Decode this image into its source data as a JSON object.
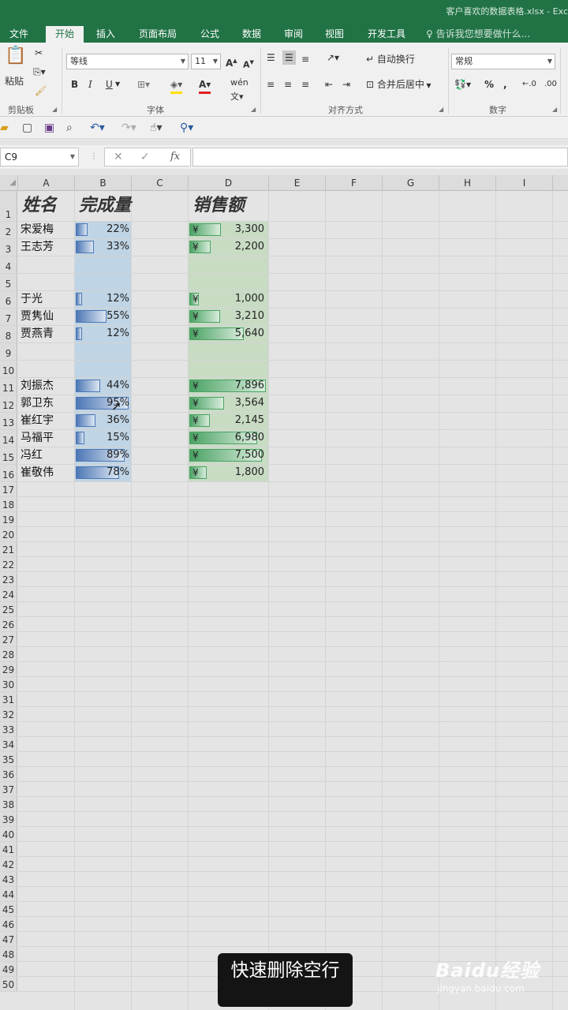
{
  "window": {
    "title": "客户喜欢的数据表格.xlsx - Exc"
  },
  "tabs": [
    {
      "label": "文件",
      "active": false
    },
    {
      "label": "开始",
      "active": true
    },
    {
      "label": "插入",
      "active": false
    },
    {
      "label": "页面布局",
      "active": false
    },
    {
      "label": "公式",
      "active": false
    },
    {
      "label": "数据",
      "active": false
    },
    {
      "label": "审阅",
      "active": false
    },
    {
      "label": "视图",
      "active": false
    },
    {
      "label": "开发工具",
      "active": false
    }
  ],
  "tell_me": "告诉我您想要做什么...",
  "ribbon": {
    "paste_label": "粘贴",
    "clipboard_label": "剪贴板",
    "font_name": "等线",
    "font_size": "11",
    "font_group_label": "字体",
    "wrap_text": "自动换行",
    "merge_center": "合并后居中",
    "align_group_label": "对齐方式",
    "number_format": "常规",
    "number_group_label": "数字",
    "bold": "B",
    "italic": "I",
    "underline": "U",
    "percent": "%",
    "comma": ","
  },
  "formula_bar": {
    "name_box": "C9",
    "fx": "fx",
    "value": ""
  },
  "columns": [
    "A",
    "B",
    "C",
    "D",
    "E",
    "F",
    "G",
    "H",
    "I"
  ],
  "header_row": {
    "col_a": "姓名",
    "col_b": "完成量",
    "col_d": "销售额"
  },
  "rows": [
    {
      "row": "2",
      "name": "宋爱梅",
      "pct": "22%",
      "pct_value": 0.22,
      "yen": "¥",
      "amount": "3,300",
      "amount_value": 3300
    },
    {
      "row": "3",
      "name": "王志芳",
      "pct": "33%",
      "pct_value": 0.33,
      "yen": "¥",
      "amount": "2,200",
      "amount_value": 2200
    },
    {
      "row": "4"
    },
    {
      "row": "5"
    },
    {
      "row": "6",
      "name": "于光",
      "pct": "12%",
      "pct_value": 0.12,
      "yen": "¥",
      "amount": "1,000",
      "amount_value": 1000
    },
    {
      "row": "7",
      "name": "贾隽仙",
      "pct": "55%",
      "pct_value": 0.55,
      "yen": "¥",
      "amount": "3,210",
      "amount_value": 3210
    },
    {
      "row": "8",
      "name": "贾燕青",
      "pct": "12%",
      "pct_value": 0.12,
      "yen": "¥",
      "amount": "5,640",
      "amount_value": 5640
    },
    {
      "row": "9"
    },
    {
      "row": "10"
    },
    {
      "row": "11",
      "name": "刘振杰",
      "pct": "44%",
      "pct_value": 0.44,
      "yen": "¥",
      "amount": "7,896",
      "amount_value": 7896
    },
    {
      "row": "12",
      "name": "郭卫东",
      "pct": "95%",
      "pct_value": 0.95,
      "yen": "¥",
      "amount": "3,564",
      "amount_value": 3564
    },
    {
      "row": "13",
      "name": "崔红宇",
      "pct": "36%",
      "pct_value": 0.36,
      "yen": "¥",
      "amount": "2,145",
      "amount_value": 2145
    },
    {
      "row": "14",
      "name": "马福平",
      "pct": "15%",
      "pct_value": 0.15,
      "yen": "¥",
      "amount": "6,980",
      "amount_value": 6980
    },
    {
      "row": "15",
      "name": "冯红",
      "pct": "89%",
      "pct_value": 0.89,
      "yen": "¥",
      "amount": "7,500",
      "amount_value": 7500
    },
    {
      "row": "16",
      "name": "崔敬伟",
      "pct": "78%",
      "pct_value": 0.78,
      "yen": "¥",
      "amount": "1,800",
      "amount_value": 1800
    }
  ],
  "empty_rows": [
    "17",
    "18",
    "19",
    "20",
    "21",
    "22",
    "23",
    "24",
    "25",
    "26",
    "27",
    "28",
    "29",
    "30",
    "31",
    "32",
    "33",
    "34",
    "35",
    "36",
    "37",
    "38",
    "39",
    "40",
    "41",
    "42",
    "43",
    "44",
    "45",
    "46",
    "47",
    "48",
    "49",
    "50"
  ],
  "header_row_label": "1",
  "caption": "快速删除空行",
  "watermark": {
    "brand": "Baidu经验",
    "site": "jingyan.baidu.com"
  },
  "colors": {
    "excel_green": "#217346",
    "bar_blue": "#4d77b5",
    "bar_green": "#4aa264"
  }
}
